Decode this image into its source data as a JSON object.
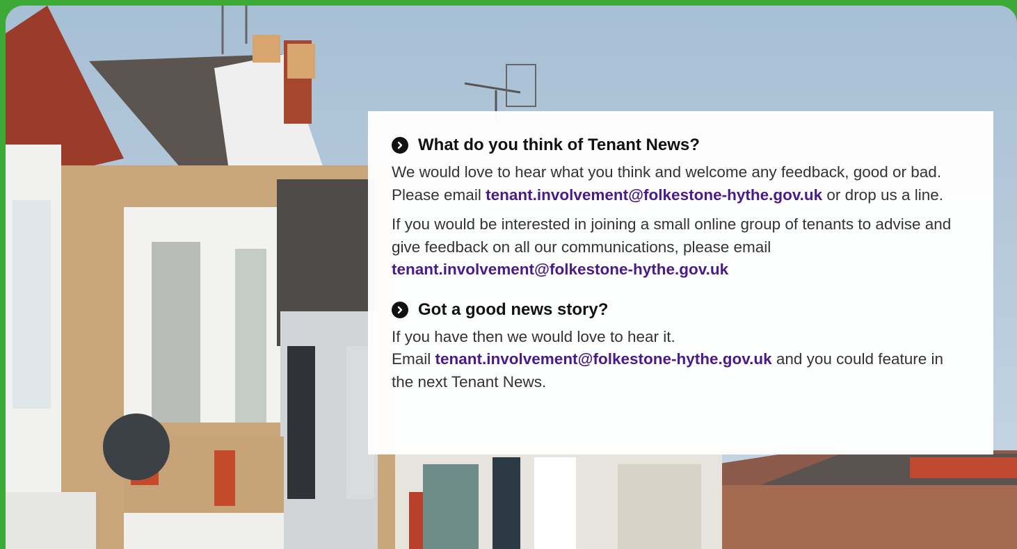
{
  "sections": [
    {
      "heading": "What do you think of Tenant News?",
      "icon": "chevron-right-circle-icon",
      "para1": {
        "before": "We would love to hear what you think and welcome any feedback, good or bad. Please email ",
        "email": "tenant.involvement@folkestone-hythe.gov.uk",
        "after": " or drop us a line."
      },
      "para2": {
        "before": "If you would be interested in joining a small online group of tenants to advise and give feedback on all our communications, please email ",
        "email": "tenant.involvement@folkestone-hythe.gov.uk"
      }
    },
    {
      "heading": "Got a good news story?",
      "icon": "chevron-right-circle-icon",
      "line1": "If you have then we would love to hear it.",
      "para": {
        "before": "Email ",
        "email": "tenant.involvement@folkestone-hythe.gov.uk",
        "after": " and you could feature in the next Tenant News."
      }
    }
  ],
  "colors": {
    "frame": "#3aa935",
    "link": "#4b1a86",
    "heading": "#111111"
  }
}
